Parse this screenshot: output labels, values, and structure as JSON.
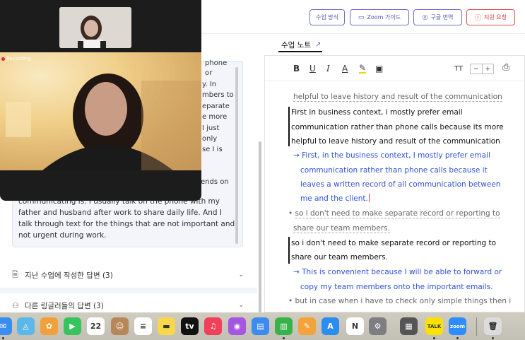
{
  "header": {
    "buttons": [
      {
        "label": "수업 방식",
        "icon": ""
      },
      {
        "label": "Zoom 가이드",
        "icon": "▭"
      },
      {
        "label": "구글 번역",
        "icon": "◎"
      },
      {
        "label": "지원 요청",
        "icon": "ⓘ"
      }
    ]
  },
  "zoom": {
    "recording_label": "Recording"
  },
  "left_panel": {
    "peek_lines": [
      "phone",
      "or",
      "y. In",
      "mbers to",
      "eparate",
      "e more",
      "I just",
      "only",
      "se I is",
      "ends on"
    ],
    "answer_text": "communicating is. I usually talk on the phone with my father and husband after work to share daily life. And I talk through text for the things that are not important and not urgent during work.",
    "accordion": [
      {
        "icon": "document-icon",
        "label": "지난 수업에 작성한 답변 (3)"
      },
      {
        "icon": "person-icon",
        "label": "다른 링글러들의 답변 (3)"
      }
    ]
  },
  "notes": {
    "tab_label": "수업 노트",
    "toolbar": {
      "bold": "B",
      "underline": "U",
      "italic": "I",
      "text_color": "A",
      "highlight": "✎",
      "image": "▣",
      "text_size": "TT",
      "minus": "−",
      "plus": "+",
      "print": "⎙"
    },
    "lines": {
      "l0": "helpful to leave history and result of the communication",
      "l1": "First in business context, i mostly prefer email",
      "l2": "communication rather than phone calls because its more",
      "l3": "helpful to leave history and result of the communication",
      "l4": "First, in the business context, I mostly prefer email",
      "l5": "communication rather than phone calls because it",
      "l6": "leaves a written record of all communication between",
      "l7": "me and the client.",
      "l8": "so i don't need to make separate record or reporting to",
      "l9": "share our team members.",
      "l10": "so i don't need to make separate record or reporting to",
      "l11": "share our team members.",
      "l12": "This is convenient because I will be able to forward or",
      "l13": "copy my team members onto the important emails.",
      "l14": "but in case when i have to check only simple things then i"
    }
  },
  "dock": {
    "items": [
      {
        "name": "mail",
        "glyph": "✉",
        "color": "#3a8df0"
      },
      {
        "name": "maps",
        "glyph": "◬",
        "color": "#5bb8e8"
      },
      {
        "name": "photos",
        "glyph": "✿",
        "color": "#f2a03a"
      },
      {
        "name": "facetime",
        "glyph": "▶",
        "color": "#36c45c"
      },
      {
        "name": "calendar",
        "glyph": "22",
        "color": "#ffffff",
        "sub": "12월"
      },
      {
        "name": "contacts",
        "glyph": "☺",
        "color": "#b88758"
      },
      {
        "name": "reminders",
        "glyph": "≡",
        "color": "#ffffff"
      },
      {
        "name": "notes",
        "glyph": "▬",
        "color": "#f8d84a"
      },
      {
        "name": "tv",
        "glyph": "tv",
        "color": "#111111"
      },
      {
        "name": "music",
        "glyph": "♫",
        "color": "#f0405a"
      },
      {
        "name": "podcasts",
        "glyph": "◉",
        "color": "#a456e0"
      },
      {
        "name": "keynote",
        "glyph": "▤",
        "color": "#3d8af0"
      },
      {
        "name": "numbers",
        "glyph": "▥",
        "color": "#37b34a"
      },
      {
        "name": "pages",
        "glyph": "✎",
        "color": "#f3a23c"
      },
      {
        "name": "app-store",
        "glyph": "A",
        "color": "#2d8cf0"
      },
      {
        "name": "notion",
        "glyph": "N",
        "color": "#ffffff"
      },
      {
        "name": "system-settings",
        "glyph": "⚙",
        "color": "#7d7d82"
      },
      {
        "name": "calculator",
        "glyph": "▦",
        "color": "#555555"
      },
      {
        "name": "kakaotalk",
        "glyph": "TALK",
        "color": "#fae100"
      },
      {
        "name": "zoom",
        "glyph": "zoom",
        "color": "#2d8cff"
      },
      {
        "name": "trash",
        "glyph": "🗑",
        "color": "#dcdcdc"
      }
    ]
  }
}
